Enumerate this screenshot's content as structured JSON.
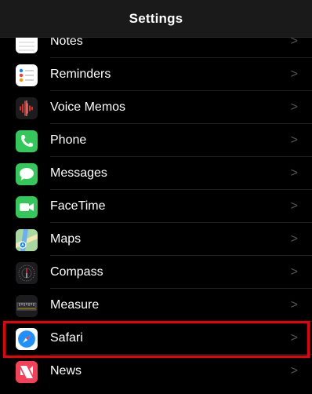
{
  "nav": {
    "title": "Settings"
  },
  "rows": [
    {
      "label": "Notes",
      "icon": "notes-icon",
      "color": "#ffffff"
    },
    {
      "label": "Reminders",
      "icon": "reminders-icon",
      "color": "#ffffff"
    },
    {
      "label": "Voice Memos",
      "icon": "voice-memos-icon",
      "color": "#1c1c1e"
    },
    {
      "label": "Phone",
      "icon": "phone-icon",
      "color": "#34c759"
    },
    {
      "label": "Messages",
      "icon": "messages-icon",
      "color": "#34c759"
    },
    {
      "label": "FaceTime",
      "icon": "facetime-icon",
      "color": "#34c759"
    },
    {
      "label": "Maps",
      "icon": "maps-icon",
      "color": "#6ab0f0"
    },
    {
      "label": "Compass",
      "icon": "compass-icon",
      "color": "#1c1c1e"
    },
    {
      "label": "Measure",
      "icon": "measure-icon",
      "color": "#1c1c1e"
    },
    {
      "label": "Safari",
      "icon": "safari-icon",
      "color": "#ffffff",
      "highlighted": true
    },
    {
      "label": "News",
      "icon": "news-icon",
      "color": "#ffffff"
    }
  ],
  "chevron": ">",
  "highlight_color": "#e8000b"
}
